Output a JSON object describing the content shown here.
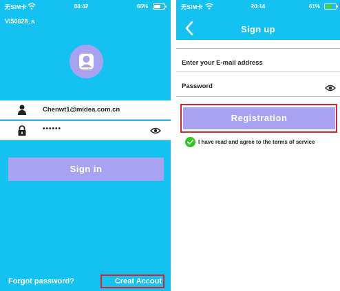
{
  "left_screen": {
    "status": {
      "carrier": "无SIM卡",
      "time": "08:42",
      "battery": "65%",
      "battery_level": 0.65
    },
    "device_name": "VI50828_a",
    "email_value": "Chenwt1@midea.com.cn",
    "password_value": "••••••",
    "sign_in_label": "Sign in",
    "forgot_password_label": "Forgot password?",
    "create_account_label": "Creat Accout",
    "icons": {
      "avatar": "user-avatar-icon",
      "email": "person-icon",
      "password": "lock-icon",
      "reveal": "eye-icon"
    }
  },
  "right_screen": {
    "status": {
      "carrier": "无SIM卡",
      "time": "20:14",
      "battery": "61%",
      "battery_level": 0.61
    },
    "title": "Sign up",
    "email_placeholder": "Enter your E-mail address",
    "password_placeholder": "Password",
    "registration_label": "Registration",
    "terms_label": "I have read and agree to the terms of service",
    "icons": {
      "back": "chevron-left-icon",
      "reveal": "eye-icon",
      "agree": "check-circle-icon"
    }
  },
  "colors": {
    "header_blue": "#14c2f2",
    "button_lavender": "#a9a2f0",
    "highlight_red": "#e2202c",
    "check_green": "#2ec51f",
    "battery_green": "#44d62c"
  }
}
